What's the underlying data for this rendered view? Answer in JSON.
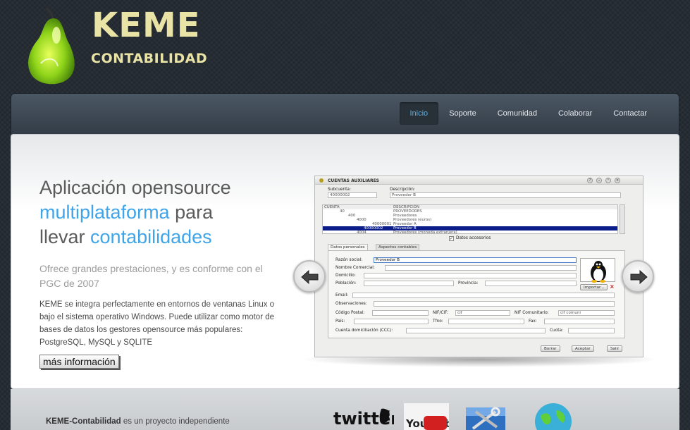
{
  "brand": {
    "title": "KEME",
    "subtitle": "CONTABILIDAD"
  },
  "nav": {
    "items": [
      {
        "label": "Inicio",
        "active": true
      },
      {
        "label": "Soporte"
      },
      {
        "label": "Comunidad"
      },
      {
        "label": "Colaborar"
      },
      {
        "label": "Contactar"
      }
    ]
  },
  "hero": {
    "headline": {
      "part1": "Aplicación opensource",
      "highlight1": "multiplataforma",
      "part2": " para",
      "part3": "llevar ",
      "highlight2": "contabilidades"
    },
    "subline": "Ofrece grandes prestaciones, y es conforme con el PGC de 2007",
    "description": "KEME se integra perfectamente en entornos de ventanas Linux o bajo el sistema operativo Windows. Puede utilizar como motor de bases de datos los gestores opensource más populares: PostgreSQL, MySQL y SQLITE",
    "more_button": "más información"
  },
  "screenshot": {
    "window_title": "CUENTAS AUXILIARES",
    "subcuenta_label": "Subcuenta:",
    "subcuenta_value": "40000002",
    "descripcion_label": "Descripción:",
    "descripcion_value": "Proveedor B",
    "tree_headers": [
      "CUENTA",
      "DESCRIPCIÓN"
    ],
    "tree_rows": [
      {
        "code": "40",
        "desc": "PROVEEDORES"
      },
      {
        "code": "400",
        "desc": "Proveedores"
      },
      {
        "code": "4000",
        "desc": "Proveedores (euros)"
      },
      {
        "code": "40000001",
        "desc": "Proveedor A"
      },
      {
        "code": "40000002",
        "desc": "Proveedor B",
        "selected": true
      },
      {
        "code": "4004",
        "desc": "Proveedores (moneda extranjera)"
      }
    ],
    "datos_accesorios": "Datos accesorios",
    "tabs": [
      "Datos personales",
      "Aspectos contables"
    ],
    "fields": {
      "razon_social": "Razón social:",
      "razon_social_value": "Proveedor B",
      "nombre_comercial": "Nombre Comercial:",
      "domicilio": "Domicilio:",
      "poblacion": "Población:",
      "provincia": "Provincia:",
      "email": "Email:",
      "observaciones": "Observaciones:",
      "codigo_postal": "Código Postal:",
      "nif_cif": "NIF/CIF:",
      "nif_cif_value": "cif",
      "nif_comunitario": "NIF Comunitario:",
      "nif_comunitario_value": "cif comuni",
      "pais": "País:",
      "tfno": "Tfno:",
      "fax": "Fax:",
      "cuenta_domiciliacion": "Cuenta domiciliación (CCC):",
      "cuota": "Cuota:"
    },
    "importar": "Importar...",
    "buttons": [
      "Borrar",
      "Aceptar",
      "Salir"
    ]
  },
  "footer": {
    "project_name": "KEME-Contabilidad",
    "text": " es un proyecto independiente",
    "icons": [
      "twitter-icon",
      "youtube-icon",
      "tools-icon",
      "globe-icon"
    ],
    "twitter_label": "twitter",
    "youtube_label": "You Tube"
  }
}
